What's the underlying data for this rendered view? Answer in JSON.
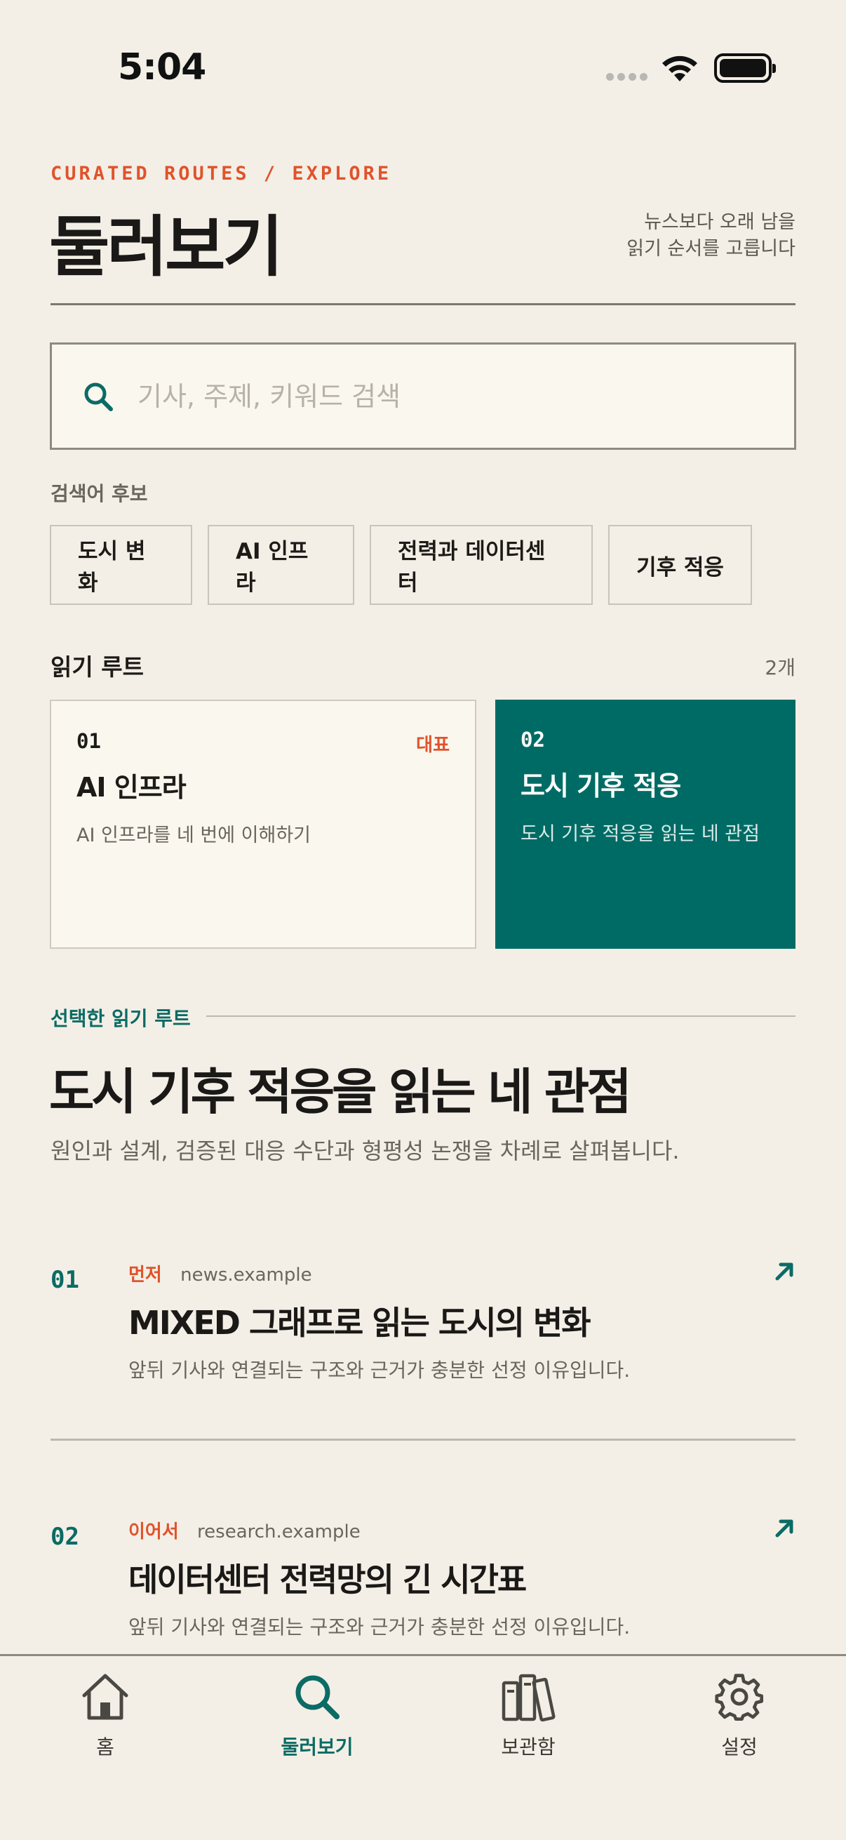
{
  "status_bar": {
    "time": "5:04"
  },
  "header": {
    "eyebrow": "CURATED ROUTES / EXPLORE",
    "title": "둘러보기",
    "description_line1": "뉴스보다 오래 남을",
    "description_line2": "읽기 순서를 고릅니다"
  },
  "search": {
    "placeholder": "기사, 주제, 키워드 검색",
    "value": ""
  },
  "suggestions": {
    "label": "검색어 후보",
    "items": [
      "도시 변화",
      "AI 인프라",
      "전력과 데이터센터",
      "기후 적응"
    ]
  },
  "routes": {
    "title": "읽기 루트",
    "count": "2개",
    "cards": [
      {
        "number": "01",
        "badge": "대표",
        "title": "AI 인프라",
        "subtitle": "AI 인프라를 네 번에 이해하기",
        "selected": false
      },
      {
        "number": "02",
        "title": "도시 기후 적응",
        "subtitle": "도시 기후 적응을 읽는 네 관점",
        "selected": true
      }
    ]
  },
  "selected_route": {
    "label": "선택한 읽기 루트",
    "title": "도시 기후 적응을 읽는 네 관점",
    "description": "원인과 설계, 검증된 대응 수단과 형평성 논쟁을 차례로 살펴봅니다."
  },
  "articles": [
    {
      "number": "01",
      "tag": "먼저",
      "source": "news.example",
      "title": "MIXED 그래프로 읽는 도시의 변화",
      "description": "앞뒤 기사와 연결되는 구조와 근거가 충분한 선정 이유입니다."
    },
    {
      "number": "02",
      "tag": "이어서",
      "source": "research.example",
      "title": "데이터센터 전력망의 긴 시간표",
      "description": "앞뒤 기사와 연결되는 구조와 근거가 충분한 선정 이유입니다."
    }
  ],
  "tabbar": {
    "active": "둘러보기",
    "tabs": [
      {
        "label": "홈",
        "icon": "home-icon"
      },
      {
        "label": "둘러보기",
        "icon": "search-icon"
      },
      {
        "label": "보관함",
        "icon": "library-icon"
      },
      {
        "label": "설정",
        "icon": "gear-icon"
      }
    ]
  },
  "colors": {
    "background": "#F3EFE6",
    "accent_orange": "#E0532C",
    "accent_teal": "#006B65",
    "text": "#1D1B18",
    "muted": "#6A655E"
  }
}
